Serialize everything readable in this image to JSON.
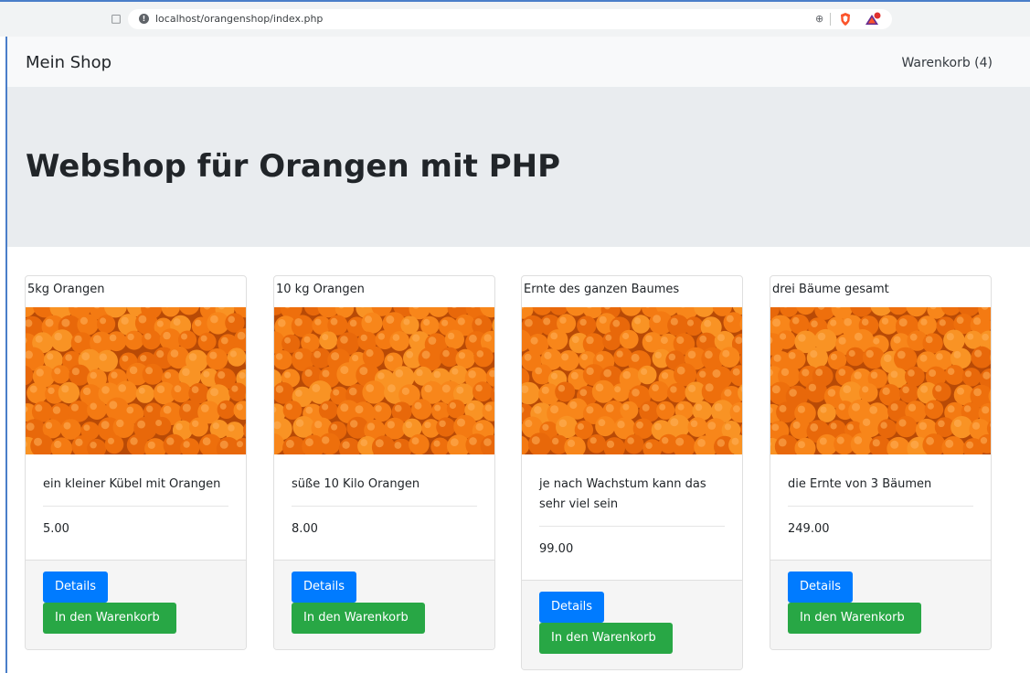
{
  "browser": {
    "url": "localhost/orangenshop/index.php",
    "icons": [
      "bookmark-icon",
      "site-info-icon",
      "zoom-icon",
      "brave-shield-icon",
      "brave-rewards-icon"
    ]
  },
  "navbar": {
    "brand": "Mein Shop",
    "cart_link": "Warenkorb (4)"
  },
  "hero": {
    "title": "Webshop für Orangen mit PHP"
  },
  "products": [
    {
      "header": "5kg Orangen",
      "description": "ein kleiner Kübel mit Orangen",
      "price": "5.00",
      "details_label": "Details",
      "cart_label": "In den Warenkorb"
    },
    {
      "header": "10 kg Orangen",
      "description": "süße 10 Kilo Orangen",
      "price": "8.00",
      "details_label": "Details",
      "cart_label": "In den Warenkorb"
    },
    {
      "header": "Ernte des ganzen Baumes",
      "description": "je nach Wachstum kann das sehr viel sein",
      "price": "99.00",
      "details_label": "Details",
      "cart_label": "In den Warenkorb"
    },
    {
      "header": "drei Bäume gesamt",
      "description": "die Ernte von 3 Bäumen",
      "price": "249.00",
      "details_label": "Details",
      "cart_label": "In den Warenkorb"
    }
  ],
  "colors": {
    "primary": "#007bff",
    "success": "#28a745",
    "jumbotron": "#e9ecef",
    "navbar": "#f8f9fa",
    "orange": "#f47a12"
  }
}
